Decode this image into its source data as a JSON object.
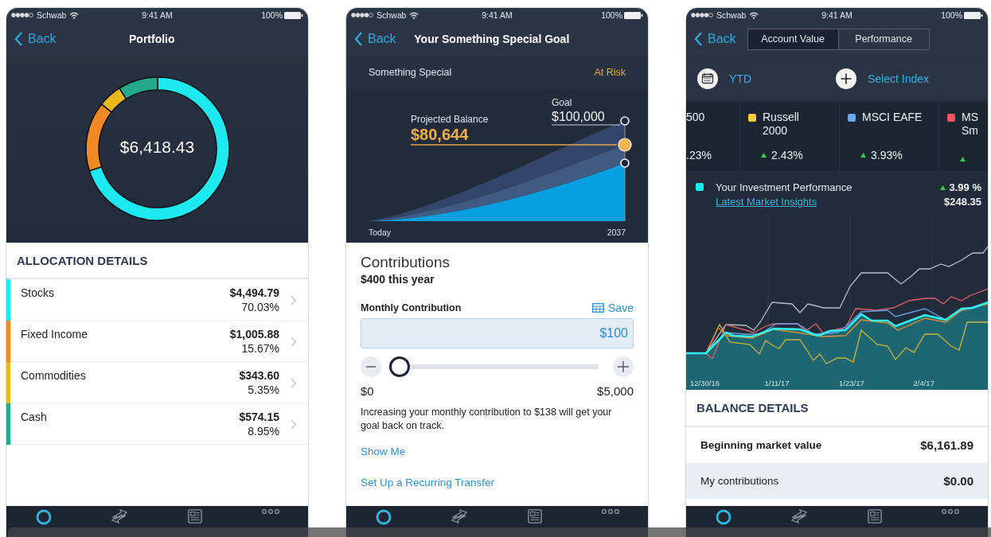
{
  "screens": [
    {
      "kind": "portfolio",
      "status_bar": {
        "carrier": "Schwab",
        "time": "9:41 AM",
        "battery": "100%"
      },
      "nav": {
        "back": "Back",
        "title": "Portfolio"
      },
      "total": "$6,418.43",
      "chart_data": {
        "type": "donut",
        "values": [
          70.03,
          15.67,
          5.35,
          8.95
        ]
      },
      "section_title": "ALLOCATION DETAILS",
      "rows": [
        {
          "name": "Stocks",
          "amount": "$4,494.79",
          "percent": "70.03%",
          "color": "#1de9f0"
        },
        {
          "name": "Fixed Income",
          "amount": "$1,005.88",
          "percent": "15.67%",
          "color": "#f08a24"
        },
        {
          "name": "Commodities",
          "amount": "$343.60",
          "percent": "5.35%",
          "color": "#e8b81c"
        },
        {
          "name": "Cash",
          "amount": "$574.15",
          "percent": "8.95%",
          "color": "#23a88a"
        }
      ],
      "tabs": [
        {
          "selected": true
        },
        {
          "selected": false
        },
        {
          "selected": false
        },
        {
          "selected": false
        }
      ]
    },
    {
      "kind": "goal",
      "status_bar": {
        "carrier": "Schwab",
        "time": "9:41 AM",
        "battery": "100%"
      },
      "nav": {
        "back": "Back",
        "title": "Your Something Special Goal"
      },
      "header": {
        "name": "Something Special",
        "status": "At Risk"
      },
      "projection": {
        "goal_label": "Goal",
        "goal_value": "$100,000",
        "projected_label": "Projected Balance",
        "projected_value": "$80,644",
        "start_label": "Today",
        "end_label": "2037"
      },
      "contributions": {
        "title": "Contributions",
        "subtitle": "$400 this year",
        "field_label": "Monthly Contribution",
        "save": "Save",
        "value": "$100",
        "slider": {
          "level": 0.02,
          "min_label": "$0",
          "max_label": "$5,000"
        },
        "message": "Increasing your monthly contribution to $138 will get your goal back on track.",
        "links": [
          "Show Me",
          "Set Up a Recurring Transfer"
        ]
      },
      "tabs": [
        {
          "selected": true
        },
        {
          "selected": false
        },
        {
          "selected": false
        },
        {
          "selected": false
        }
      ]
    },
    {
      "kind": "performance",
      "status_bar": {
        "carrier": "Schwab",
        "time": "9:41 AM",
        "battery": "100%"
      },
      "nav": {
        "back": "Back",
        "segments": [
          {
            "label": "Account Value",
            "selected": true
          },
          {
            "label": "Performance",
            "selected": false
          }
        ]
      },
      "period": "YTD",
      "select_index": "Select Index",
      "indexes": [
        {
          "name": [
            "500"
          ],
          "change": ".23%"
        },
        {
          "name": [
            "Russell",
            "2000"
          ],
          "color": "#f2cd3c",
          "change": "2.43%",
          "up": true
        },
        {
          "name": [
            "MSCI EAFE"
          ],
          "color": "#6aa7ee",
          "change": "3.93%",
          "up": true
        },
        {
          "name": [
            "MS",
            "Sm"
          ],
          "color": "#e8585c",
          "up": true
        }
      ],
      "performance": {
        "color": "#1de9f0",
        "title": "Your Investment Performance",
        "link": "Latest Market Insights",
        "change": "3.99 %",
        "up": true,
        "amount": "$248.35"
      },
      "chart_x_labels": [
        "12/30/16",
        "1/11/17",
        "1/23/17",
        "2/4/17"
      ],
      "balance": {
        "title": "BALANCE DETAILS",
        "rows": [
          {
            "label": "Beginning market value",
            "value": "$6,161.89",
            "kind": "bold"
          },
          {
            "label": "My contributions",
            "value": "$0.00",
            "kind": "plain"
          }
        ]
      },
      "tabs": [
        {
          "selected": true
        },
        {
          "selected": false
        },
        {
          "selected": false
        },
        {
          "selected": false
        }
      ]
    }
  ]
}
